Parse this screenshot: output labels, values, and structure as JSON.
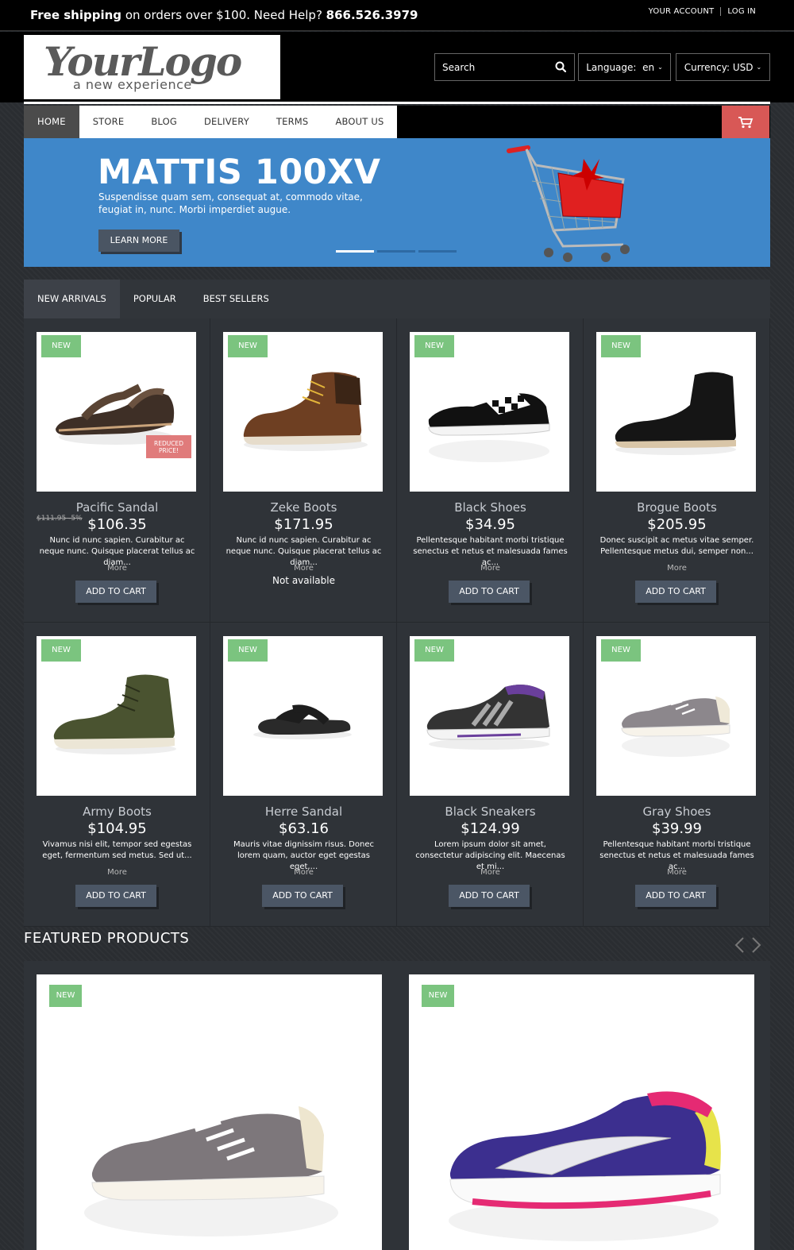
{
  "topbar": {
    "shipping_bold": "Free shipping",
    "shipping_rest": " on orders over $100. Need Help? ",
    "phone": "866.526.3979",
    "account": "YOUR ACCOUNT",
    "login": "LOG IN"
  },
  "header": {
    "logo_main": "YourLogo",
    "logo_sub": "a new experience",
    "search_placeholder": "Search",
    "language_label": "Language:",
    "language_value": "en",
    "currency_label": "Currency:",
    "currency_value": "USD"
  },
  "nav": {
    "items": [
      "HOME",
      "STORE",
      "BLOG",
      "DELIVERY",
      "TERMS",
      "ABOUT US"
    ]
  },
  "banner": {
    "title": "MATTIS 100XV",
    "text": "Suspendisse quam sem, consequat at, commodo vitae, feugiat in, nunc. Morbi imperdiet augue.",
    "button": "LEARN MORE",
    "slides": 3,
    "active_slide": 1
  },
  "tabs": [
    "NEW ARRIVALS",
    "POPULAR",
    "BEST SELLERS"
  ],
  "products": [
    {
      "name": "Pacific Sandal",
      "price": "$106.35",
      "old_price": "$111.95 -5%",
      "badge": "NEW",
      "reduced": "REDUCED PRICE!",
      "desc": "Nunc id nunc sapien. Curabitur ac neque nunc. Quisque placerat tellus ac diam...",
      "more": "More",
      "button": "ADD TO CART"
    },
    {
      "name": "Zeke Boots",
      "price": "$171.95",
      "badge": "NEW",
      "desc": "Nunc id nunc sapien. Curabitur ac neque nunc. Quisque placerat tellus ac diam...",
      "more": "More",
      "availability": "Not available"
    },
    {
      "name": "Black Shoes",
      "price": "$34.95",
      "badge": "NEW",
      "desc": "Pellentesque habitant morbi tristique senectus et netus et malesuada fames ac...",
      "more": "More",
      "button": "ADD TO CART"
    },
    {
      "name": "Brogue Boots",
      "price": "$205.95",
      "badge": "NEW",
      "desc": "Donec suscipit ac metus vitae semper. Pellentesque metus dui, semper non...",
      "more": "More",
      "button": "ADD TO CART"
    },
    {
      "name": "Army Boots",
      "price": "$104.95",
      "badge": "NEW",
      "desc": "Vivamus nisi elit, tempor sed egestas eget, fermentum sed metus. Sed ut...",
      "more": "More",
      "button": "ADD TO CART"
    },
    {
      "name": "Herre Sandal",
      "price": "$63.16",
      "badge": "NEW",
      "desc": "Mauris vitae dignissim risus. Donec lorem quam, auctor eget egestas eget,...",
      "more": "More",
      "button": "ADD TO CART"
    },
    {
      "name": "Black Sneakers",
      "price": "$124.99",
      "badge": "NEW",
      "desc": "Lorem ipsum dolor sit amet, consectetur adipiscing elit. Maecenas et mi...",
      "more": "More",
      "button": "ADD TO CART"
    },
    {
      "name": "Gray Shoes",
      "price": "$39.99",
      "badge": "NEW",
      "desc": "Pellentesque habitant morbi tristique senectus et netus et malesuada fames ac...",
      "more": "More",
      "button": "ADD TO CART"
    }
  ],
  "featured": {
    "title": "FEATURED PRODUCTS",
    "items": [
      {
        "badge": "NEW",
        "icon": "gray-sneaker"
      },
      {
        "badge": "NEW",
        "icon": "purple-running-shoe"
      }
    ]
  },
  "colors": {
    "accent_red": "#d85856",
    "banner_blue": "#3f87c9",
    "badge_green": "#7bc47f",
    "button_slate": "#4b5665"
  }
}
